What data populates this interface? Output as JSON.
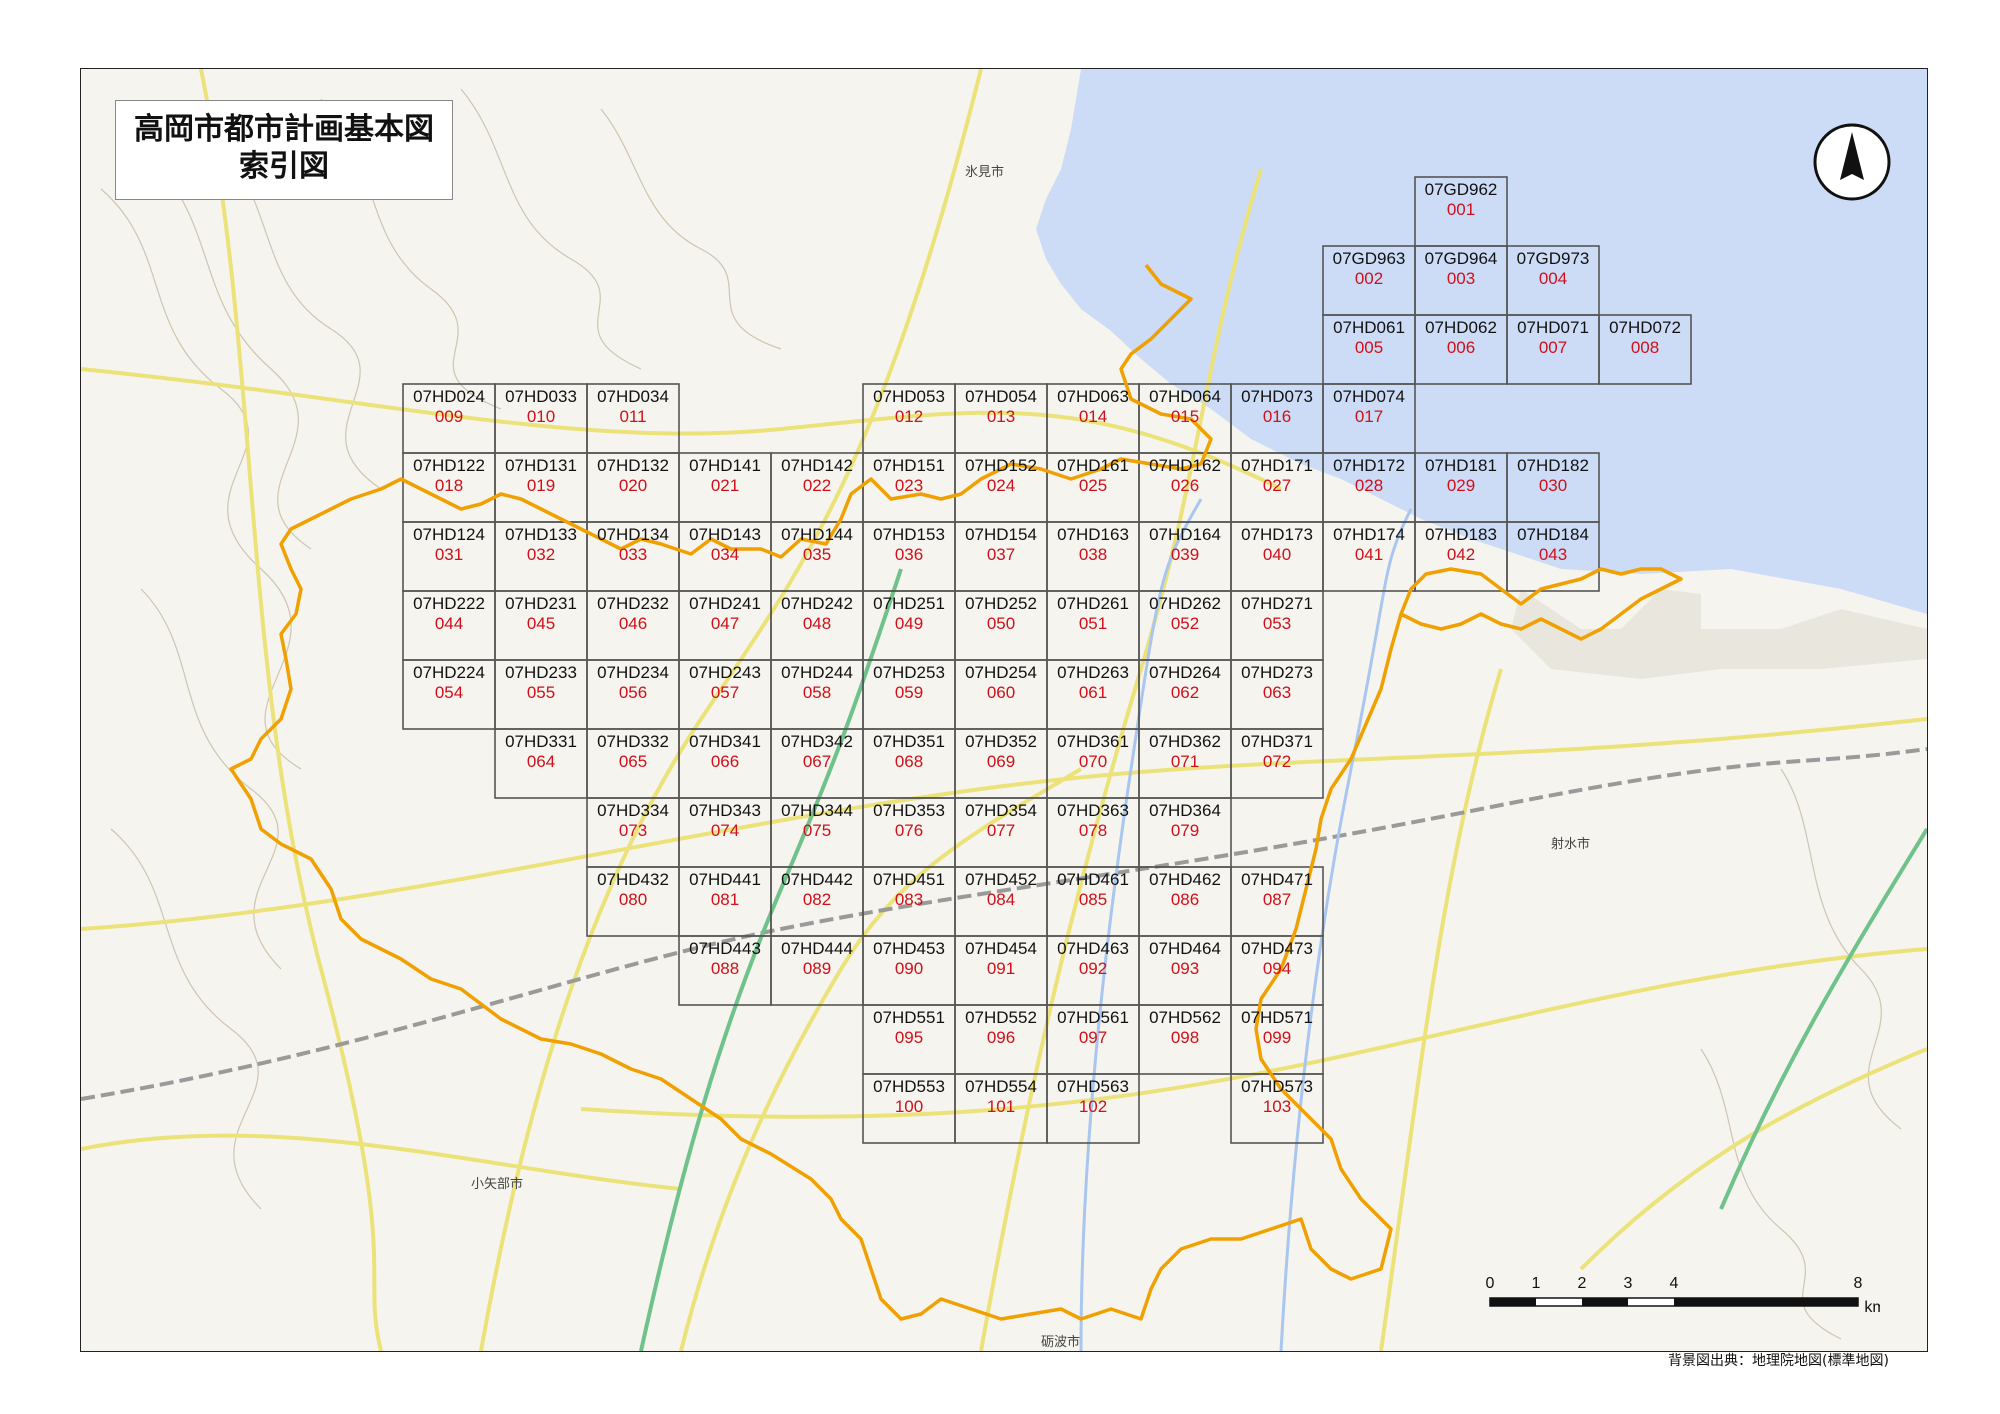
{
  "title_line1": "高岡市都市計画基本図",
  "title_line2": "索引図",
  "attribution": "背景図出典：地理院地図(標準地図)",
  "scale": {
    "ticks": [
      "0",
      "1",
      "2",
      "3",
      "4",
      "8"
    ],
    "unit": "km"
  },
  "north_icon": "north-arrow-icon",
  "colors": {
    "sea": "#cddcf6",
    "land": "#f6f4ee",
    "boundary": "#f0a000",
    "grid": "#555555",
    "tile_number": "#d0101a",
    "road": "#ece27a",
    "rail": "#9a9a9a"
  },
  "places": {
    "himi": "氷見市",
    "imizu": "射水市",
    "oyabe": "小矢部市",
    "tonami": "砺波市"
  },
  "tiles": [
    {
      "code": "07GD962",
      "num": "001"
    },
    {
      "code": "07GD963",
      "num": "002"
    },
    {
      "code": "07GD964",
      "num": "003"
    },
    {
      "code": "07GD973",
      "num": "004"
    },
    {
      "code": "07HD061",
      "num": "005"
    },
    {
      "code": "07HD062",
      "num": "006"
    },
    {
      "code": "07HD071",
      "num": "007"
    },
    {
      "code": "07HD072",
      "num": "008"
    },
    {
      "code": "07HD024",
      "num": "009"
    },
    {
      "code": "07HD033",
      "num": "010"
    },
    {
      "code": "07HD034",
      "num": "011"
    },
    {
      "code": "07HD053",
      "num": "012"
    },
    {
      "code": "07HD054",
      "num": "013"
    },
    {
      "code": "07HD063",
      "num": "014"
    },
    {
      "code": "07HD064",
      "num": "015"
    },
    {
      "code": "07HD073",
      "num": "016"
    },
    {
      "code": "07HD074",
      "num": "017"
    },
    {
      "code": "07HD122",
      "num": "018"
    },
    {
      "code": "07HD131",
      "num": "019"
    },
    {
      "code": "07HD132",
      "num": "020"
    },
    {
      "code": "07HD141",
      "num": "021"
    },
    {
      "code": "07HD142",
      "num": "022"
    },
    {
      "code": "07HD151",
      "num": "023"
    },
    {
      "code": "07HD152",
      "num": "024"
    },
    {
      "code": "07HD161",
      "num": "025"
    },
    {
      "code": "07HD162",
      "num": "026"
    },
    {
      "code": "07HD171",
      "num": "027"
    },
    {
      "code": "07HD172",
      "num": "028"
    },
    {
      "code": "07HD181",
      "num": "029"
    },
    {
      "code": "07HD182",
      "num": "030"
    },
    {
      "code": "07HD124",
      "num": "031"
    },
    {
      "code": "07HD133",
      "num": "032"
    },
    {
      "code": "07HD134",
      "num": "033"
    },
    {
      "code": "07HD143",
      "num": "034"
    },
    {
      "code": "07HD144",
      "num": "035"
    },
    {
      "code": "07HD153",
      "num": "036"
    },
    {
      "code": "07HD154",
      "num": "037"
    },
    {
      "code": "07HD163",
      "num": "038"
    },
    {
      "code": "07HD164",
      "num": "039"
    },
    {
      "code": "07HD173",
      "num": "040"
    },
    {
      "code": "07HD174",
      "num": "041"
    },
    {
      "code": "07HD183",
      "num": "042"
    },
    {
      "code": "07HD184",
      "num": "043"
    },
    {
      "code": "07HD222",
      "num": "044"
    },
    {
      "code": "07HD231",
      "num": "045"
    },
    {
      "code": "07HD232",
      "num": "046"
    },
    {
      "code": "07HD241",
      "num": "047"
    },
    {
      "code": "07HD242",
      "num": "048"
    },
    {
      "code": "07HD251",
      "num": "049"
    },
    {
      "code": "07HD252",
      "num": "050"
    },
    {
      "code": "07HD261",
      "num": "051"
    },
    {
      "code": "07HD262",
      "num": "052"
    },
    {
      "code": "07HD271",
      "num": "053"
    },
    {
      "code": "07HD224",
      "num": "054"
    },
    {
      "code": "07HD233",
      "num": "055"
    },
    {
      "code": "07HD234",
      "num": "056"
    },
    {
      "code": "07HD243",
      "num": "057"
    },
    {
      "code": "07HD244",
      "num": "058"
    },
    {
      "code": "07HD253",
      "num": "059"
    },
    {
      "code": "07HD254",
      "num": "060"
    },
    {
      "code": "07HD263",
      "num": "061"
    },
    {
      "code": "07HD264",
      "num": "062"
    },
    {
      "code": "07HD273",
      "num": "063"
    },
    {
      "code": "07HD331",
      "num": "064"
    },
    {
      "code": "07HD332",
      "num": "065"
    },
    {
      "code": "07HD341",
      "num": "066"
    },
    {
      "code": "07HD342",
      "num": "067"
    },
    {
      "code": "07HD351",
      "num": "068"
    },
    {
      "code": "07HD352",
      "num": "069"
    },
    {
      "code": "07HD361",
      "num": "070"
    },
    {
      "code": "07HD362",
      "num": "071"
    },
    {
      "code": "07HD371",
      "num": "072"
    },
    {
      "code": "07HD334",
      "num": "073"
    },
    {
      "code": "07HD343",
      "num": "074"
    },
    {
      "code": "07HD344",
      "num": "075"
    },
    {
      "code": "07HD353",
      "num": "076"
    },
    {
      "code": "07HD354",
      "num": "077"
    },
    {
      "code": "07HD363",
      "num": "078"
    },
    {
      "code": "07HD364",
      "num": "079"
    },
    {
      "code": "07HD432",
      "num": "080"
    },
    {
      "code": "07HD441",
      "num": "081"
    },
    {
      "code": "07HD442",
      "num": "082"
    },
    {
      "code": "07HD451",
      "num": "083"
    },
    {
      "code": "07HD452",
      "num": "084"
    },
    {
      "code": "07HD461",
      "num": "085"
    },
    {
      "code": "07HD462",
      "num": "086"
    },
    {
      "code": "07HD471",
      "num": "087"
    },
    {
      "code": "07HD443",
      "num": "088"
    },
    {
      "code": "07HD444",
      "num": "089"
    },
    {
      "code": "07HD453",
      "num": "090"
    },
    {
      "code": "07HD454",
      "num": "091"
    },
    {
      "code": "07HD463",
      "num": "092"
    },
    {
      "code": "07HD464",
      "num": "093"
    },
    {
      "code": "07HD473",
      "num": "094"
    },
    {
      "code": "07HD551",
      "num": "095"
    },
    {
      "code": "07HD552",
      "num": "096"
    },
    {
      "code": "07HD561",
      "num": "097"
    },
    {
      "code": "07HD562",
      "num": "098"
    },
    {
      "code": "07HD571",
      "num": "099"
    },
    {
      "code": "07HD553",
      "num": "100"
    },
    {
      "code": "07HD554",
      "num": "101"
    },
    {
      "code": "07HD563",
      "num": "102"
    },
    {
      "code": "07HD573",
      "num": "103"
    }
  ]
}
